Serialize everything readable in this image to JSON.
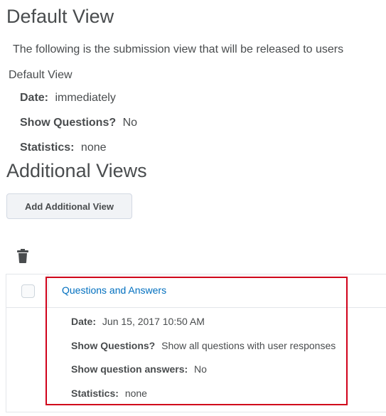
{
  "default_view": {
    "heading": "Default View",
    "description": "The following is the submission view that will be released to users",
    "link_label": "Default View",
    "date_label": "Date:",
    "date_value": "immediately",
    "show_questions_label": "Show Questions?",
    "show_questions_value": "No",
    "statistics_label": "Statistics:",
    "statistics_value": "none"
  },
  "additional_views": {
    "heading": "Additional Views",
    "add_button_label": "Add Additional View",
    "delete_icon": "trash-icon",
    "rows": [
      {
        "title": "Questions and Answers",
        "date_label": "Date:",
        "date_value": "Jun 15, 2017 10:50 AM",
        "show_questions_label": "Show Questions?",
        "show_questions_value": "Show all questions with user responses",
        "show_answers_label": "Show question answers:",
        "show_answers_value": "No",
        "statistics_label": "Statistics:",
        "statistics_value": "none"
      }
    ]
  },
  "colors": {
    "link": "#006fbf",
    "text": "#494c4e",
    "highlight": "#d0021b"
  }
}
